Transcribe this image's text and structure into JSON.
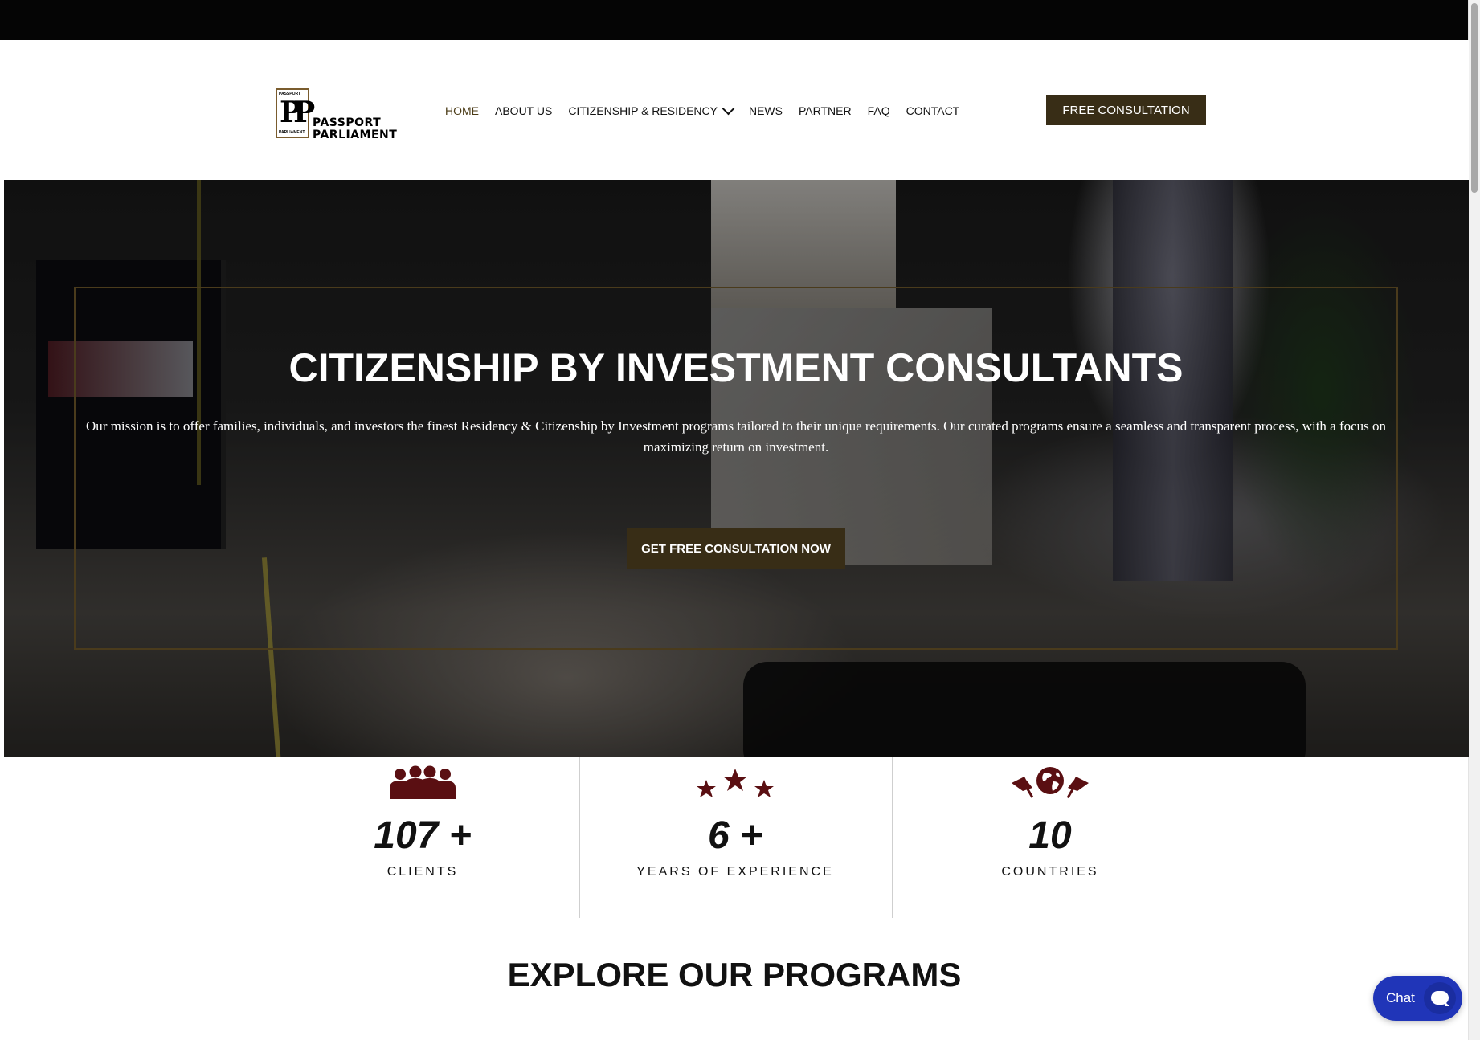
{
  "logo": {
    "mark_text": "PP",
    "top_text": "PASSPORT",
    "bottom_text": "PARLIAMENT",
    "wordmark": [
      "PASSPORT",
      "PARLIAMENT"
    ]
  },
  "nav": {
    "items": [
      {
        "label": "HOME",
        "active": true
      },
      {
        "label": "ABOUT US"
      },
      {
        "label": "CITIZENSHIP & RESIDENCY",
        "has_dropdown": true
      },
      {
        "label": "NEWS"
      },
      {
        "label": "PARTNER"
      },
      {
        "label": "FAQ"
      },
      {
        "label": "CONTACT"
      }
    ]
  },
  "header": {
    "cta_label": "FREE CONSULTATION"
  },
  "hero": {
    "title": "CITIZENSHIP BY INVESTMENT CONSULTANTS",
    "description": "Our mission is to offer families, individuals, and investors the finest Residency & Citizenship by Investment programs tailored to their unique requirements. Our curated programs ensure a seamless and transparent process, with a focus on maximizing return on investment.",
    "cta_label": "GET FREE CONSULTATION NOW"
  },
  "stats": [
    {
      "icon": "people-group-icon",
      "value": "107  +",
      "label": "CLIENTS"
    },
    {
      "icon": "three-stars-icon",
      "value": "6 +",
      "label": "YEARS OF EXPERIENCE"
    },
    {
      "icon": "globe-flags-icon",
      "value": "10",
      "label": "COUNTRIES"
    }
  ],
  "programs": {
    "title": "EXPLORE OUR PROGRAMS"
  },
  "chat": {
    "label": "Chat",
    "icon": "chat-bubble-icon"
  },
  "colors": {
    "brand_dark": "#382d16",
    "accent_icon": "#5a0f12",
    "chat_blue": "#2035b8",
    "frame_gold": "#4a3b1c"
  }
}
